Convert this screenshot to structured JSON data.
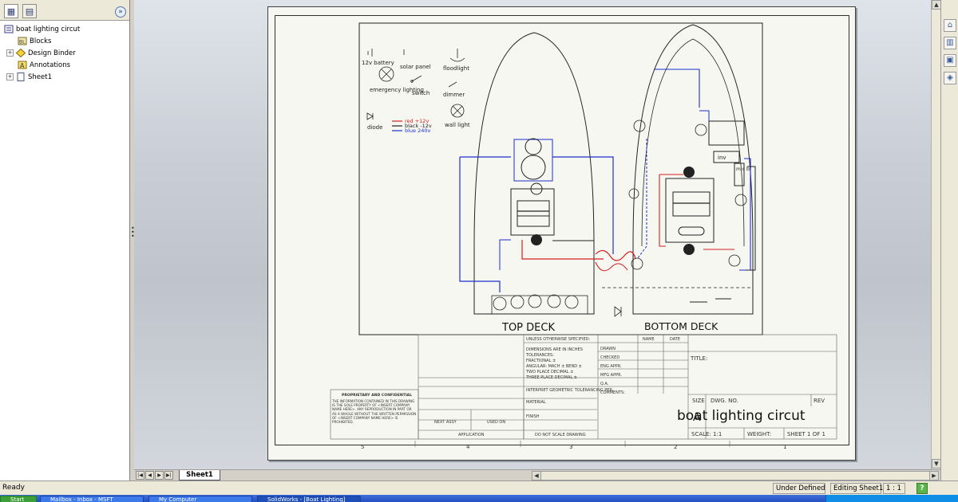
{
  "feature_tree": {
    "root": "boat lighting circut",
    "items": [
      {
        "label": "Blocks",
        "icon": "blocks-icon",
        "expandable": false
      },
      {
        "label": "Design Binder",
        "icon": "design-binder-icon",
        "expandable": true
      },
      {
        "label": "Annotations",
        "icon": "annotations-icon",
        "expandable": false
      },
      {
        "label": "Sheet1",
        "icon": "sheet-icon",
        "expandable": true
      }
    ]
  },
  "legend": {
    "battery": "12v battery",
    "solar_panel": "solar panel",
    "floodlight": "floodlight",
    "emergency": "emergency lighting",
    "switch": "switch",
    "dimmer": "dimmer",
    "diode": "diode",
    "red": "red +12v",
    "black": "black -12v",
    "blue": "blue 240v",
    "wall_light": "wall light"
  },
  "deck_labels": {
    "top": "TOP DECK",
    "bottom": "BOTTOM DECK"
  },
  "component_labels": {
    "inv": "inv",
    "mcb": "m c b"
  },
  "title_block": {
    "unless": "UNLESS OTHERWISE SPECIFIED:",
    "name_col": "NAME",
    "date_col": "DATE",
    "dims": "DIMENSIONS ARE IN INCHES",
    "tolerances": "TOLERANCES:",
    "fractional": "FRACTIONAL ±",
    "angular": "ANGULAR: MACH ±    BEND ±",
    "two_place": "TWO PLACE DECIMAL    ±",
    "three_place": "THREE PLACE DECIMAL  ±",
    "drawn": "DRAWN",
    "checked": "CHECKED",
    "eng_appr": "ENG APPR.",
    "mfg_appr": "MFG APPR.",
    "qa": "Q.A.",
    "comments": "COMMENTS:",
    "interpret": "INTERPRET GEOMETRIC TOLERANCING PER:",
    "material": "MATERIAL",
    "finish": "FINISH",
    "next_assy": "NEXT ASSY",
    "used_on": "USED ON",
    "application": "APPLICATION",
    "do_not_scale": "DO NOT SCALE DRAWING",
    "proprietary_title": "PROPRIETARY AND CONFIDENTIAL",
    "proprietary_text": "THE INFORMATION CONTAINED IN THIS DRAWING IS THE SOLE PROPERTY OF <INSERT COMPANY NAME HERE>. ANY REPRODUCTION IN PART OR AS A WHOLE WITHOUT THE WRITTEN PERMISSION OF <INSERT COMPANY NAME HERE> IS PROHIBITED.",
    "title_label": "TITLE:",
    "size_label": "SIZE",
    "size": "A",
    "dwg_no_label": "DWG.  NO.",
    "dwg_no": "boat lighting circut",
    "rev_label": "REV",
    "scale": "SCALE: 1:1",
    "weight": "WEIGHT:",
    "sheet": "SHEET 1 OF 1"
  },
  "zone_numbers": [
    "5",
    "4",
    "3",
    "2",
    "1"
  ],
  "sheet_tab": "Sheet1",
  "status": {
    "ready": "Ready",
    "under_defined": "Under Defined",
    "editing": "Editing Sheet1",
    "scale": "1 : 1"
  },
  "taskbar": [
    {
      "label": "Start"
    },
    {
      "label": "Mailbox - Inbox - MSFT"
    },
    {
      "label": "My Computer"
    },
    {
      "label": "SolidWorks - [Boat Lighting]"
    }
  ],
  "colors": {
    "wire_red": "#d42020",
    "wire_blue": "#1b2fd0",
    "wire_black": "#202020",
    "sheet_bg": "#f7f7f1"
  }
}
